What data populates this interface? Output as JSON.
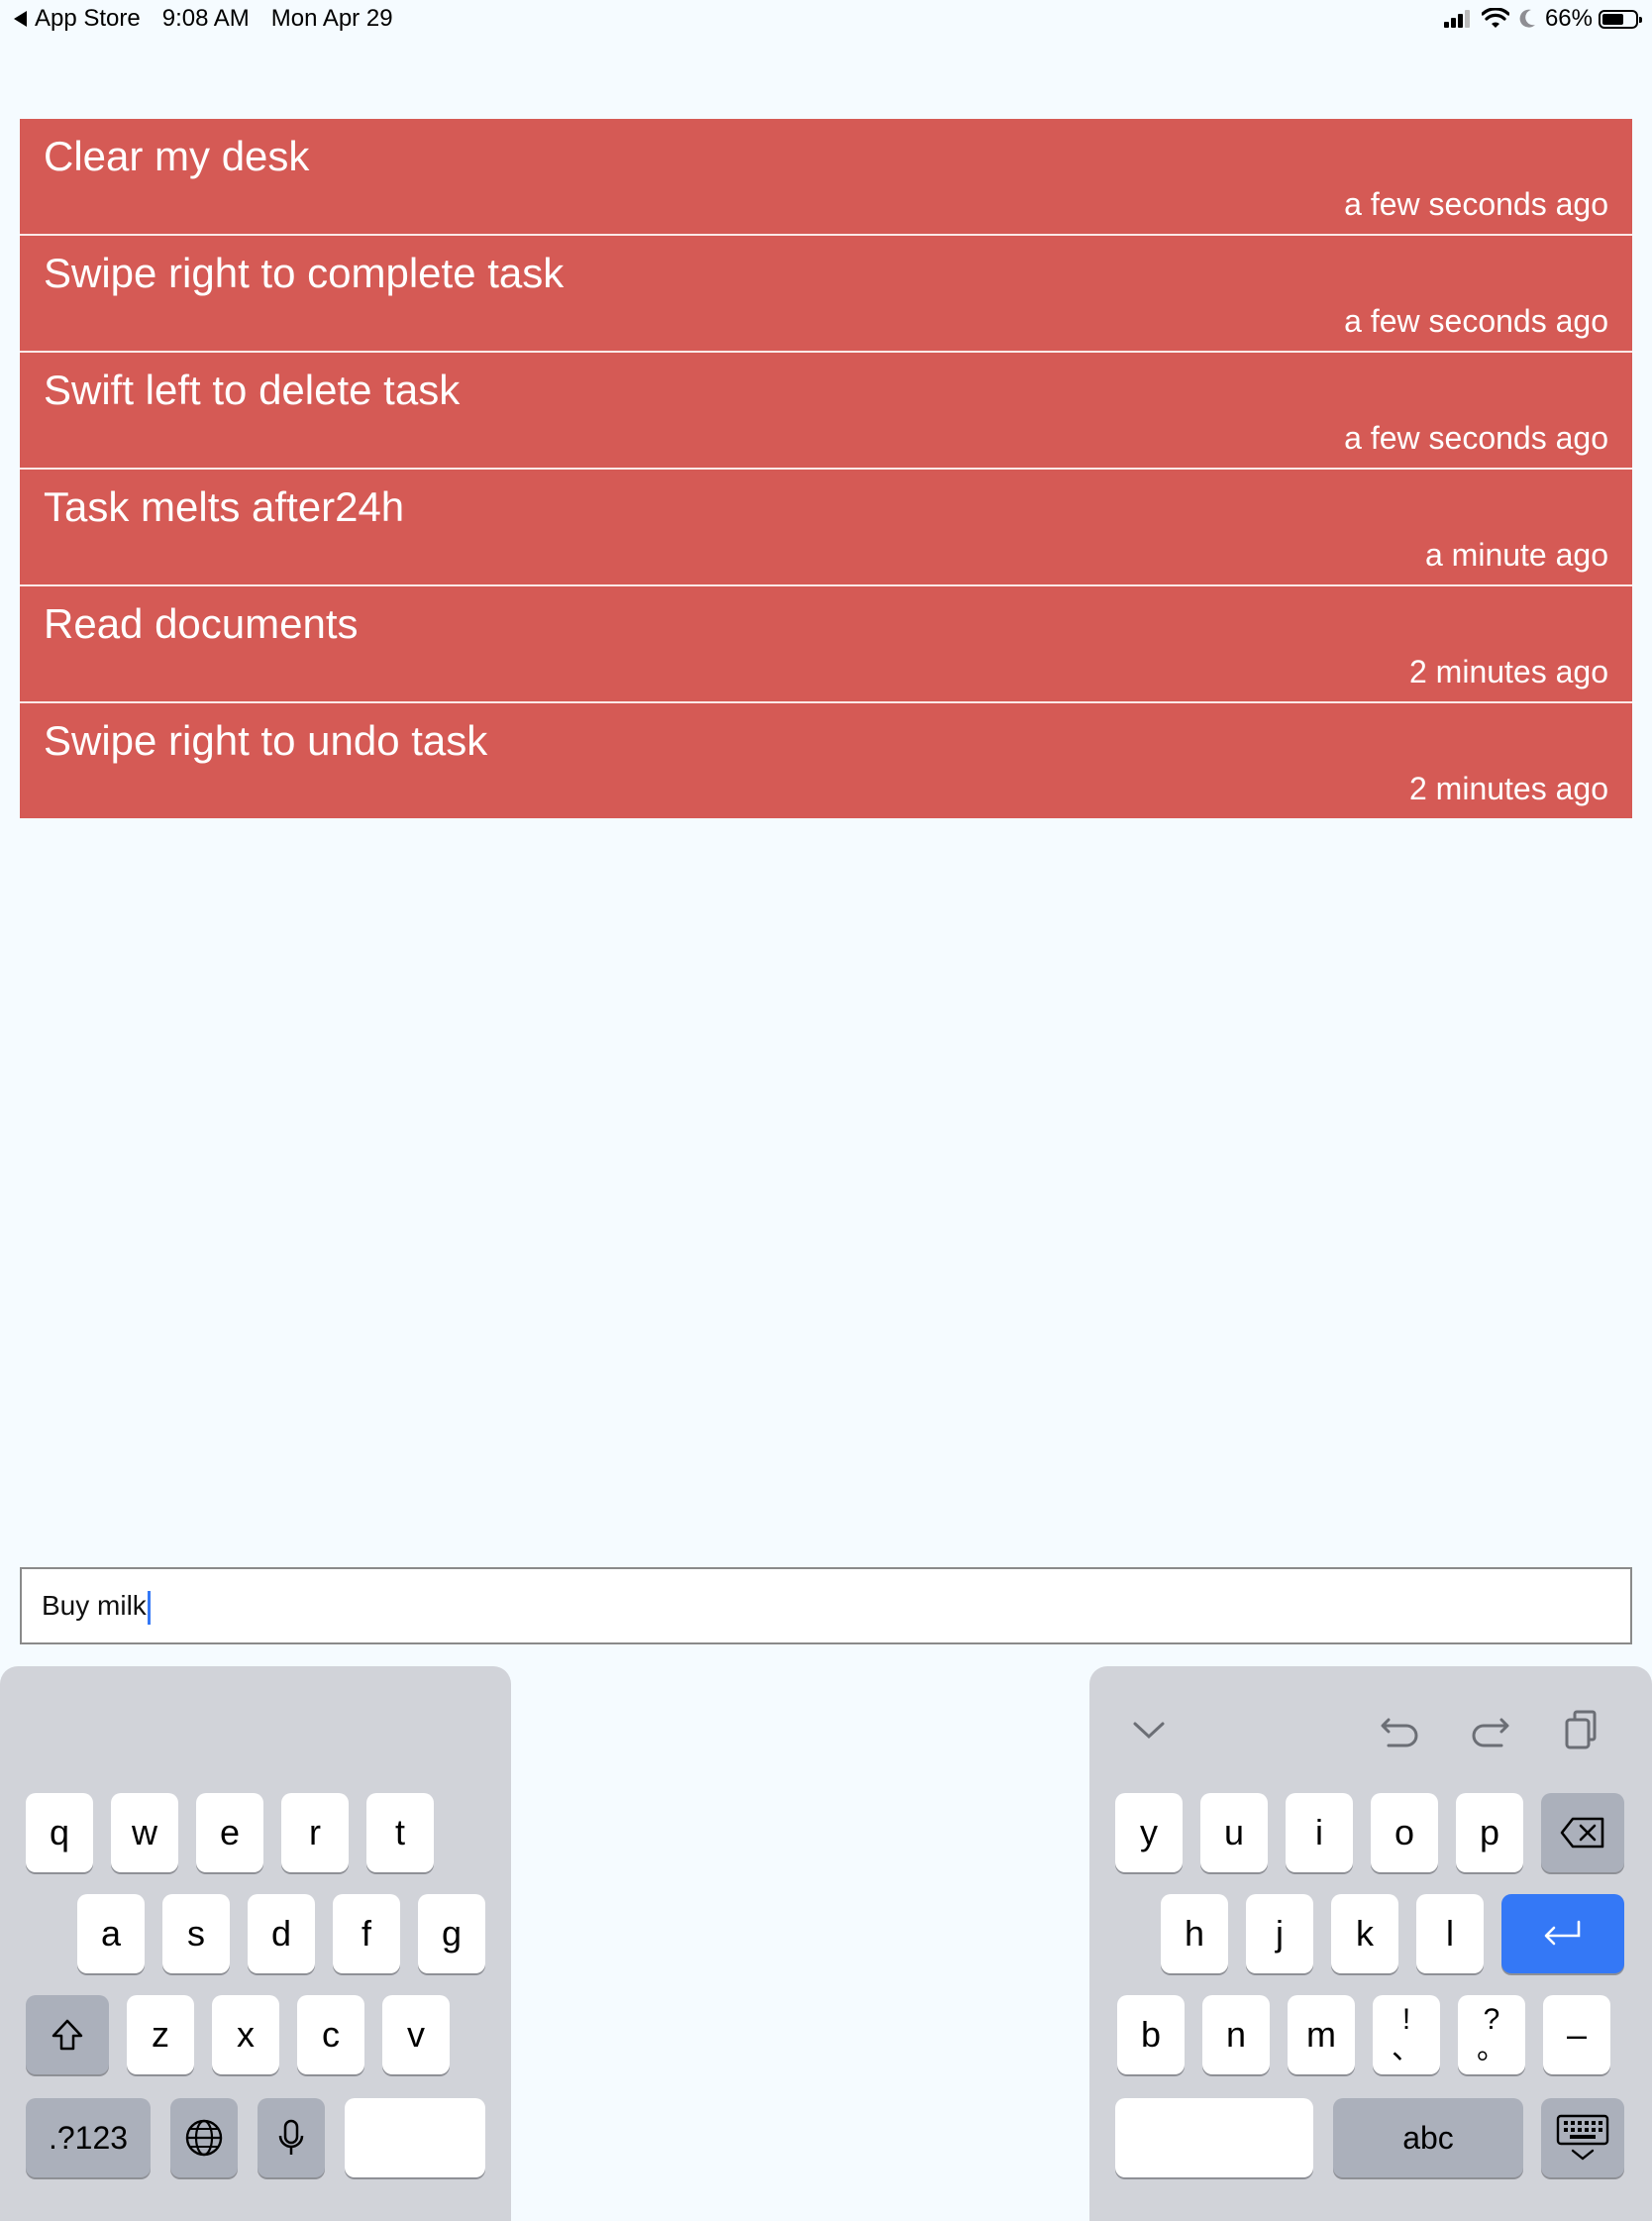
{
  "status_bar": {
    "back_app": "App Store",
    "time": "9:08 AM",
    "date": "Mon Apr 29",
    "battery_percent": "66%",
    "battery_level": 0.66,
    "icons": [
      "signal-icon",
      "wifi-icon",
      "moon-icon",
      "battery-icon"
    ]
  },
  "tasks": [
    {
      "title": "Clear my desk",
      "time": "a few seconds ago"
    },
    {
      "title": "Swipe right to complete task",
      "time": "a few seconds ago"
    },
    {
      "title": "Swift left to delete task",
      "time": "a few seconds ago"
    },
    {
      "title": "Task melts after24h",
      "time": "a minute ago"
    },
    {
      "title": "Read documents",
      "time": "2 minutes ago"
    },
    {
      "title": "Swipe right to undo task",
      "time": "2 minutes ago"
    }
  ],
  "task_color": "#d55a55",
  "input": {
    "value": "Buy milk"
  },
  "keyboard": {
    "left": {
      "row1": [
        "q",
        "w",
        "e",
        "r",
        "t"
      ],
      "row2": [
        "a",
        "s",
        "d",
        "f",
        "g"
      ],
      "row3": [
        "z",
        "x",
        "c",
        "v"
      ],
      "numbers_key": ".?123"
    },
    "right": {
      "row1": [
        "y",
        "u",
        "i",
        "o",
        "p"
      ],
      "row2": [
        "h",
        "j",
        "k",
        "l"
      ],
      "row3": [
        "b",
        "n",
        "m"
      ],
      "punct1": [
        "!",
        "、"
      ],
      "punct2": [
        "?",
        "。"
      ],
      "dash": "–",
      "abc_key": "abc"
    },
    "accent_color": "#3478f6"
  }
}
